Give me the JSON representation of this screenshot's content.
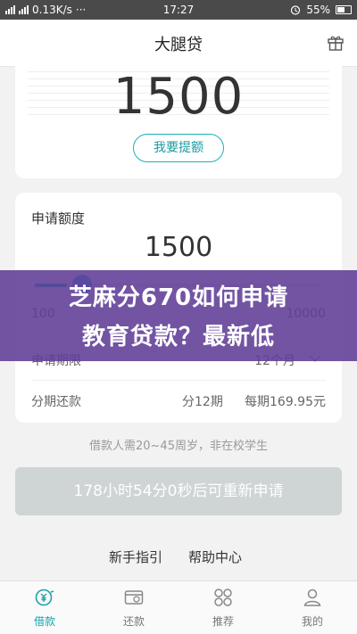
{
  "status_bar": {
    "network_speed": "0.13K/s",
    "more": "···",
    "time": "17:27",
    "battery_percent": "55%"
  },
  "nav": {
    "title": "大腿贷"
  },
  "limit_card": {
    "amount": "1500",
    "raise_button": "我要提额"
  },
  "apply": {
    "label": "申请额度",
    "amount": "1500",
    "slider_min": "100",
    "slider_max": "10000",
    "term_label": "申请期限",
    "term_value": "12个月",
    "repay_label": "分期还款",
    "repay_periods": "分12期",
    "repay_monthly": "每期169.95元"
  },
  "eligibility_note": "借款人需20~45周岁，非在校学生",
  "reapply_button": "178小时54分0秒后可重新申请",
  "links": {
    "guide": "新手指引",
    "help": "帮助中心"
  },
  "tabs": [
    {
      "label": "借款",
      "icon": "loan-icon",
      "active": true
    },
    {
      "label": "还款",
      "icon": "repay-icon",
      "active": false
    },
    {
      "label": "推荐",
      "icon": "recommend-icon",
      "active": false
    },
    {
      "label": "我的",
      "icon": "profile-icon",
      "active": false
    }
  ],
  "overlay": {
    "line1": "芝麻分670如何申请",
    "line2": "教育贷款？最新低"
  },
  "colors": {
    "accent": "#1aa4ad",
    "overlay": "#5f3c96"
  }
}
